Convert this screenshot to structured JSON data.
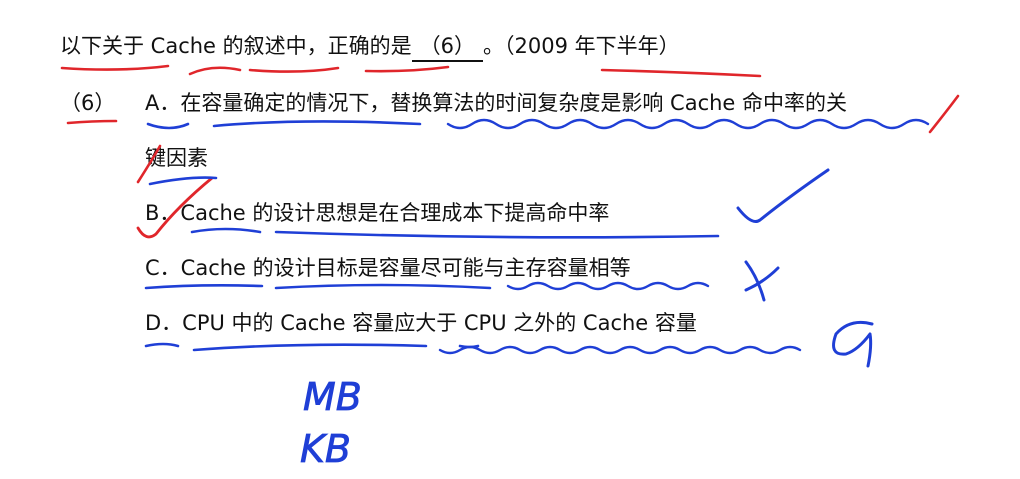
{
  "question": {
    "stem_prefix": "以下关于 Cache 的叙述中，正确的是",
    "blank": "（6）",
    "stem_suffix": "。（2009 年下半年）"
  },
  "number": "（6）",
  "options": [
    {
      "text": "A．在容量确定的情况下，替换算法的时间复杂度是影响 Cache 命中率的关"
    },
    {
      "text": "键因素"
    },
    {
      "text": "B．Cache 的设计思想是在合理成本下提高命中率"
    },
    {
      "text": "C．Cache 的设计目标是容量尽可能与主存容量相等"
    },
    {
      "text": "D．CPU 中的 Cache 容量应大于 CPU 之外的 Cache 容量"
    }
  ],
  "handwriting": {
    "note_1": "MB",
    "note_2": "KB",
    "colors": {
      "red": "#e0262b",
      "blue": "#1f3fd6"
    }
  }
}
